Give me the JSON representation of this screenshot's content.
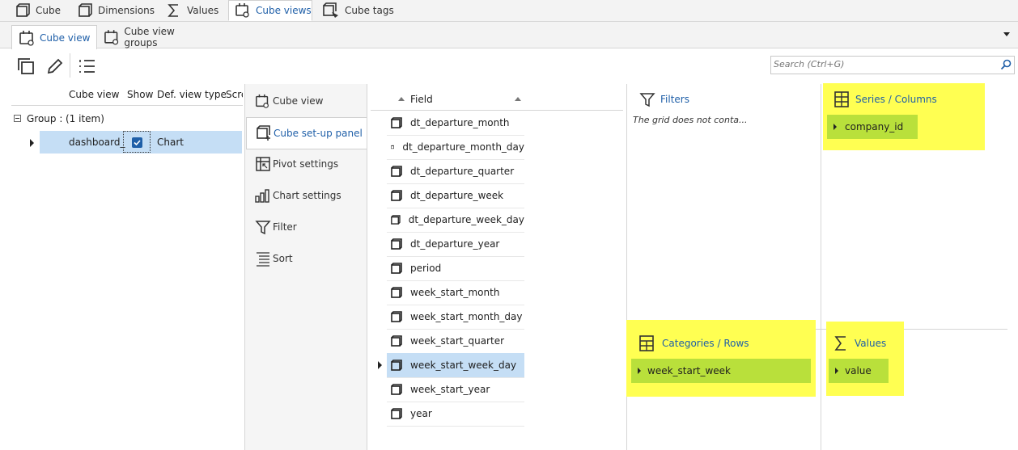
{
  "top_tabs": [
    {
      "label": "Cube",
      "icon": "cube-icon"
    },
    {
      "label": "Dimensions",
      "icon": "cube-icon"
    },
    {
      "label": "Values",
      "icon": "sigma-icon"
    },
    {
      "label": "Cube views",
      "icon": "cube-view-icon"
    },
    {
      "label": "Cube tags",
      "icon": "cube-tag-icon"
    }
  ],
  "sub_tabs": [
    {
      "label": "Cube view"
    },
    {
      "label": "Cube view groups"
    }
  ],
  "search": {
    "placeholder": "Search (Ctrl+G)"
  },
  "grid": {
    "columns": [
      "Cube view",
      "Show",
      "Def. view type",
      "Scre"
    ],
    "group_label": "Group :",
    "group_count": "(1 item)",
    "rows": [
      {
        "cube_view": "dashboard_",
        "show": true,
        "view_type": "Chart"
      }
    ]
  },
  "setup_menu": [
    {
      "label": "Cube view",
      "icon": "cube-view-icon"
    },
    {
      "label": "Cube set-up panel",
      "icon": "cube-setup-icon"
    },
    {
      "label": "Pivot settings",
      "icon": "pivot-icon"
    },
    {
      "label": "Chart settings",
      "icon": "bar-chart-icon"
    },
    {
      "label": "Filter",
      "icon": "filter-icon"
    },
    {
      "label": "Sort",
      "icon": "sort-icon"
    }
  ],
  "field_list": {
    "header": "Field",
    "items": [
      "dt_departure_month",
      "dt_departure_month_day",
      "dt_departure_quarter",
      "dt_departure_week",
      "dt_departure_week_day",
      "dt_departure_year",
      "period",
      "week_start_month",
      "week_start_month_day",
      "week_start_quarter",
      "week_start_week_day",
      "week_start_year",
      "year"
    ],
    "selected": "week_start_week_day"
  },
  "filters": {
    "title": "Filters",
    "empty_text": "The grid does not conta..."
  },
  "series": {
    "title": "Series / Columns",
    "items": [
      "company_id"
    ]
  },
  "categories": {
    "title": "Categories / Rows",
    "items": [
      "week_start_week"
    ]
  },
  "values": {
    "title": "Values",
    "items": [
      "value"
    ]
  },
  "colors": {
    "accent": "#1f5fa8",
    "highlight": "#ffff52",
    "chip": "#b9e03b",
    "selection": "#c5def5"
  }
}
